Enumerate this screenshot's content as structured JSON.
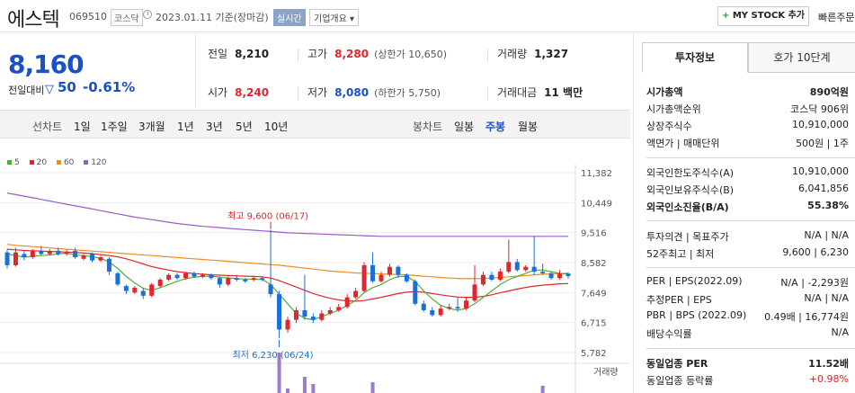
{
  "header": {
    "stock_name": "에스텍",
    "stock_code": "069510",
    "market": "코스닥",
    "date_text": "2023.01.11 기준(장마감)",
    "realtime_label": "실시간",
    "overview_label": "기업개요",
    "mystock_label": "MY STOCK 추가",
    "quickorder_label": "빠른주문"
  },
  "price": {
    "current": "8,160",
    "change_label": "전일대비",
    "change_value": "50",
    "change_rate": "-0.61%"
  },
  "summary": {
    "prev_label": "전일",
    "prev_value": "8,210",
    "high_label": "고가",
    "high_value": "8,280",
    "upper_limit": "(상한가 10,650)",
    "volume_label": "거래량",
    "volume_value": "1,327",
    "open_label": "시가",
    "open_value": "8,240",
    "low_label": "저가",
    "low_value": "8,080",
    "lower_limit": "(하한가 5,750)",
    "amount_label": "거래대금",
    "amount_value": "11 백만"
  },
  "period_bar": {
    "line_chart": "선차트",
    "periods": [
      "1일",
      "1주일",
      "3개월",
      "1년",
      "3년",
      "5년",
      "10년"
    ],
    "candle_chart": "봉차트",
    "candle_periods": [
      "일봉",
      "주봉",
      "월봉"
    ],
    "active_candle": "주봉"
  },
  "legend": [
    {
      "name": "5",
      "color": "#4caf3a"
    },
    {
      "name": "20",
      "color": "#e0262e"
    },
    {
      "name": "60",
      "color": "#f08c1e"
    },
    {
      "name": "120",
      "color": "#9a5cc8"
    }
  ],
  "chart_data": {
    "type": "candlestick",
    "y_ticks": [
      "11,382",
      "10,449",
      "9,516",
      "8,582",
      "7,649",
      "6,715",
      "5,782"
    ],
    "ylim": [
      5782,
      11382
    ],
    "annotation_high": "최고 9,600 (06/17)",
    "annotation_low": "최저 6,230 (06/24)",
    "volume_label": "거래량",
    "candles": [
      {
        "o": 8900,
        "c": 8500,
        "h": 9000,
        "l": 8400
      },
      {
        "o": 8500,
        "c": 8900,
        "h": 9050,
        "l": 8450
      },
      {
        "o": 8850,
        "c": 8750,
        "h": 8950,
        "l": 8650
      },
      {
        "o": 8750,
        "c": 8950,
        "h": 9000,
        "l": 8700
      },
      {
        "o": 8950,
        "c": 8850,
        "h": 9100,
        "l": 8800
      },
      {
        "o": 8850,
        "c": 8950,
        "h": 9000,
        "l": 8800
      },
      {
        "o": 8950,
        "c": 8850,
        "h": 9050,
        "l": 8800
      },
      {
        "o": 8850,
        "c": 8900,
        "h": 8980,
        "l": 8800
      },
      {
        "o": 8950,
        "c": 8750,
        "h": 9050,
        "l": 8700
      },
      {
        "o": 8700,
        "c": 8800,
        "h": 8850,
        "l": 8650
      },
      {
        "o": 8850,
        "c": 8650,
        "h": 8900,
        "l": 8600
      },
      {
        "o": 8650,
        "c": 8750,
        "h": 8800,
        "l": 8600
      },
      {
        "o": 8700,
        "c": 8300,
        "h": 8750,
        "l": 8200
      },
      {
        "o": 8250,
        "c": 7900,
        "h": 8300,
        "l": 7850
      },
      {
        "o": 7850,
        "c": 7700,
        "h": 7900,
        "l": 7600
      },
      {
        "o": 7650,
        "c": 7800,
        "h": 7850,
        "l": 7600
      },
      {
        "o": 7700,
        "c": 7550,
        "h": 7800,
        "l": 7450
      },
      {
        "o": 7550,
        "c": 7900,
        "h": 7950,
        "l": 7500
      },
      {
        "o": 7850,
        "c": 8050,
        "h": 8100,
        "l": 7800
      },
      {
        "o": 8050,
        "c": 8200,
        "h": 8250,
        "l": 8000
      },
      {
        "o": 8200,
        "c": 8100,
        "h": 8250,
        "l": 8050
      },
      {
        "o": 8100,
        "c": 8250,
        "h": 8300,
        "l": 8050
      },
      {
        "o": 8250,
        "c": 8150,
        "h": 8300,
        "l": 8100
      },
      {
        "o": 8150,
        "c": 8200,
        "h": 8250,
        "l": 8100
      },
      {
        "o": 8200,
        "c": 8100,
        "h": 8250,
        "l": 8050
      },
      {
        "o": 8100,
        "c": 7900,
        "h": 8150,
        "l": 7800
      },
      {
        "o": 7900,
        "c": 8100,
        "h": 8150,
        "l": 7850
      },
      {
        "o": 8100,
        "c": 8050,
        "h": 8200,
        "l": 8000
      },
      {
        "o": 8050,
        "c": 8000,
        "h": 8100,
        "l": 7950
      },
      {
        "o": 8050,
        "c": 8100,
        "h": 8150,
        "l": 8000
      },
      {
        "o": 8100,
        "c": 8050,
        "h": 8150,
        "l": 8000
      },
      {
        "o": 7900,
        "c": 7600,
        "h": 9600,
        "l": 7500
      },
      {
        "o": 7600,
        "c": 6500,
        "h": 7700,
        "l": 6230
      },
      {
        "o": 6500,
        "c": 6800,
        "h": 6900,
        "l": 6400
      },
      {
        "o": 6800,
        "c": 7100,
        "h": 7200,
        "l": 6700
      },
      {
        "o": 7100,
        "c": 6900,
        "h": 8200,
        "l": 6800
      },
      {
        "o": 6900,
        "c": 6800,
        "h": 7000,
        "l": 6700
      },
      {
        "o": 6800,
        "c": 7000,
        "h": 7100,
        "l": 6750
      },
      {
        "o": 7000,
        "c": 7100,
        "h": 7200,
        "l": 6950
      },
      {
        "o": 7100,
        "c": 7200,
        "h": 7300,
        "l": 7050
      },
      {
        "o": 7200,
        "c": 7500,
        "h": 7600,
        "l": 7150
      },
      {
        "o": 7500,
        "c": 7700,
        "h": 7800,
        "l": 7450
      },
      {
        "o": 7700,
        "c": 8500,
        "h": 8600,
        "l": 7650
      },
      {
        "o": 8500,
        "c": 8000,
        "h": 8900,
        "l": 7950
      },
      {
        "o": 8000,
        "c": 8200,
        "h": 8300,
        "l": 7950
      },
      {
        "o": 8200,
        "c": 8450,
        "h": 8550,
        "l": 8150
      },
      {
        "o": 8450,
        "c": 8200,
        "h": 8500,
        "l": 8100
      },
      {
        "o": 8200,
        "c": 8000,
        "h": 8250,
        "l": 7950
      },
      {
        "o": 8000,
        "c": 7300,
        "h": 8050,
        "l": 7250
      },
      {
        "o": 7300,
        "c": 7100,
        "h": 7400,
        "l": 7050
      },
      {
        "o": 7100,
        "c": 6950,
        "h": 7200,
        "l": 6900
      },
      {
        "o": 6950,
        "c": 7150,
        "h": 7250,
        "l": 6900
      },
      {
        "o": 7150,
        "c": 7200,
        "h": 7300,
        "l": 7100
      },
      {
        "o": 7200,
        "c": 7150,
        "h": 7500,
        "l": 7050
      },
      {
        "o": 7150,
        "c": 7400,
        "h": 7500,
        "l": 7100
      },
      {
        "o": 7400,
        "c": 7900,
        "h": 8500,
        "l": 7350
      },
      {
        "o": 7900,
        "c": 8200,
        "h": 8300,
        "l": 7850
      },
      {
        "o": 8200,
        "c": 8050,
        "h": 8300,
        "l": 8000
      },
      {
        "o": 8050,
        "c": 8300,
        "h": 8400,
        "l": 8000
      },
      {
        "o": 8300,
        "c": 8600,
        "h": 9300,
        "l": 8250
      },
      {
        "o": 8600,
        "c": 8350,
        "h": 8700,
        "l": 8300
      },
      {
        "o": 8350,
        "c": 8450,
        "h": 8500,
        "l": 8300
      },
      {
        "o": 8450,
        "c": 8300,
        "h": 9400,
        "l": 8200
      },
      {
        "o": 8300,
        "c": 8250,
        "h": 8550,
        "l": 8200
      },
      {
        "o": 8250,
        "c": 8100,
        "h": 8300,
        "l": 8050
      },
      {
        "o": 8100,
        "c": 8240,
        "h": 8350,
        "l": 8050
      },
      {
        "o": 8240,
        "c": 8160,
        "h": 8280,
        "l": 8080
      }
    ],
    "ma5": [
      8850,
      8800,
      8750,
      8780,
      8800,
      8820,
      8850,
      8880,
      8820,
      8800,
      8760,
      8720,
      8600,
      8400,
      8150,
      7950,
      7780,
      7720,
      7800,
      7900,
      8000,
      8080,
      8130,
      8150,
      8160,
      8130,
      8100,
      8080,
      8070,
      8060,
      8060,
      7900,
      7600,
      7300,
      7000,
      6850,
      6800,
      6900,
      7000,
      7100,
      7250,
      7400,
      7650,
      7800,
      7900,
      8050,
      8150,
      8150,
      8000,
      7700,
      7450,
      7250,
      7150,
      7100,
      7150,
      7300,
      7500,
      7700,
      7900,
      8050,
      8150,
      8250,
      8350,
      8350,
      8300,
      8250,
      8220
    ],
    "ma20": [
      9000,
      8980,
      8960,
      8950,
      8940,
      8930,
      8920,
      8910,
      8900,
      8880,
      8860,
      8830,
      8800,
      8760,
      8700,
      8620,
      8540,
      8460,
      8400,
      8350,
      8300,
      8270,
      8240,
      8220,
      8200,
      8190,
      8180,
      8170,
      8160,
      8150,
      8140,
      8100,
      8020,
      7920,
      7820,
      7720,
      7620,
      7540,
      7470,
      7420,
      7390,
      7380,
      7400,
      7450,
      7500,
      7560,
      7620,
      7660,
      7680,
      7660,
      7620,
      7580,
      7540,
      7510,
      7500,
      7500,
      7530,
      7580,
      7640,
      7700,
      7760,
      7810,
      7850,
      7880,
      7900,
      7920,
      7930
    ],
    "ma60": [
      9150,
      9120,
      9100,
      9080,
      9060,
      9040,
      9020,
      9000,
      8980,
      8960,
      8940,
      8920,
      8900,
      8880,
      8860,
      8840,
      8820,
      8800,
      8780,
      8760,
      8740,
      8720,
      8700,
      8680,
      8660,
      8640,
      8620,
      8600,
      8580,
      8560,
      8540,
      8520,
      8500,
      8470,
      8440,
      8410,
      8380,
      8350,
      8320,
      8300,
      8280,
      8260,
      8250,
      8240,
      8230,
      8220,
      8210,
      8200,
      8180,
      8160,
      8140,
      8120,
      8100,
      8090,
      8080,
      8080,
      8090,
      8100,
      8120,
      8140,
      8160,
      8180,
      8200,
      8220,
      8230,
      8240,
      8250
    ],
    "ma120": [
      10750,
      10700,
      10650,
      10600,
      10550,
      10500,
      10450,
      10400,
      10350,
      10300,
      10250,
      10200,
      10150,
      10100,
      10050,
      10000,
      9960,
      9920,
      9880,
      9840,
      9800,
      9770,
      9740,
      9710,
      9690,
      9670,
      9650,
      9630,
      9610,
      9590,
      9570,
      9550,
      9530,
      9510,
      9500,
      9490,
      9480,
      9470,
      9460,
      9450,
      9440,
      9430,
      9420,
      9410,
      9400,
      9400,
      9400,
      9400,
      9400,
      9400,
      9400,
      9400,
      9400,
      9400,
      9400,
      9400,
      9400,
      9400,
      9400,
      9400,
      9400,
      9400,
      9400,
      9400,
      9400,
      9400,
      9400
    ],
    "volume": [
      0,
      0,
      0,
      0,
      0,
      0,
      0,
      0,
      0,
      0,
      0,
      0,
      0,
      0,
      0,
      0,
      0,
      0,
      0,
      0,
      0,
      0,
      0,
      0,
      0,
      0,
      0,
      0,
      0,
      0,
      0,
      0,
      45,
      5,
      0,
      18,
      10,
      0,
      0,
      0,
      0,
      0,
      0,
      12,
      0,
      0,
      0,
      0,
      0,
      0,
      0,
      0,
      0,
      0,
      0,
      0,
      0,
      0,
      0,
      0,
      0,
      0,
      0,
      8,
      0,
      0,
      0
    ]
  },
  "right_panel": {
    "tabs": [
      "투자정보",
      "호가 10단계"
    ],
    "rows1": [
      {
        "l": "시가총액",
        "r": "890억원",
        "bold": true
      },
      {
        "l": "시가총액순위",
        "r": "코스닥 906위"
      },
      {
        "l": "상장주식수",
        "r": "10,910,000"
      },
      {
        "l": "액면가 | 매매단위",
        "r": "500원 | 1주"
      }
    ],
    "rows2": [
      {
        "l": "외국인한도주식수(A)",
        "r": "10,910,000"
      },
      {
        "l": "외국인보유주식수(B)",
        "r": "6,041,856"
      },
      {
        "l": "외국인소진율(B/A)",
        "r": "55.38%",
        "bold": true
      }
    ],
    "rows3": [
      {
        "l": "투자의견 | 목표주가",
        "r": "N/A | N/A"
      },
      {
        "l": "52주최고 | 최저",
        "r": "9,600 | 6,230"
      }
    ],
    "rows4": [
      {
        "l": "PER | EPS(2022.09)",
        "r": "N/A | -2,293원"
      },
      {
        "l": "추정PER | EPS",
        "r": "N/A | N/A"
      },
      {
        "l": "PBR | BPS (2022.09)",
        "r": "0.49배 | 16,774원"
      },
      {
        "l": "배당수익률",
        "r": "N/A"
      }
    ],
    "rows5": [
      {
        "l": "동일업종 PER",
        "r": "11.52배",
        "bold": true
      },
      {
        "l": "동일업종 등락률",
        "r": "+0.98%",
        "red": true
      }
    ]
  }
}
